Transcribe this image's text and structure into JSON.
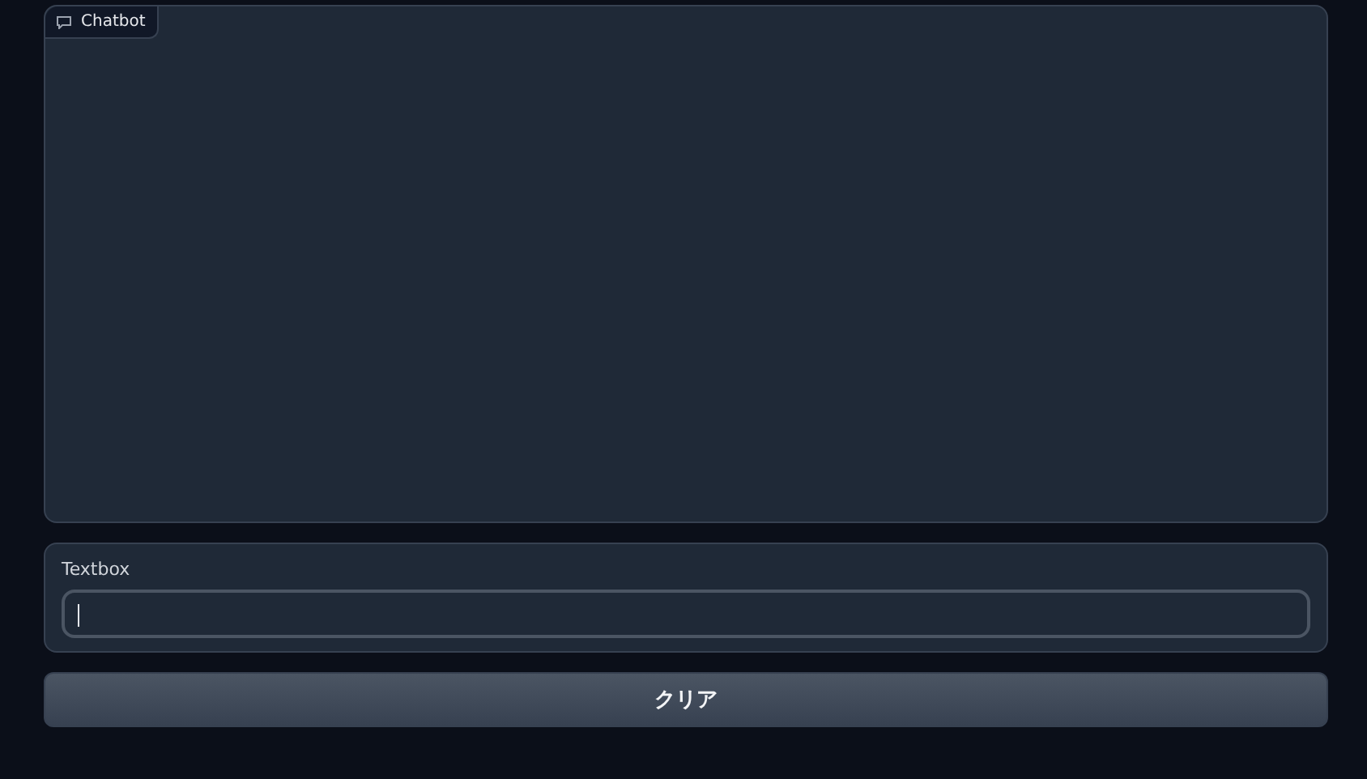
{
  "chatbot": {
    "label": "Chatbot"
  },
  "textbox": {
    "label": "Textbox",
    "focused": true
  },
  "buttons": [
    {
      "label": "クリア"
    }
  ]
}
